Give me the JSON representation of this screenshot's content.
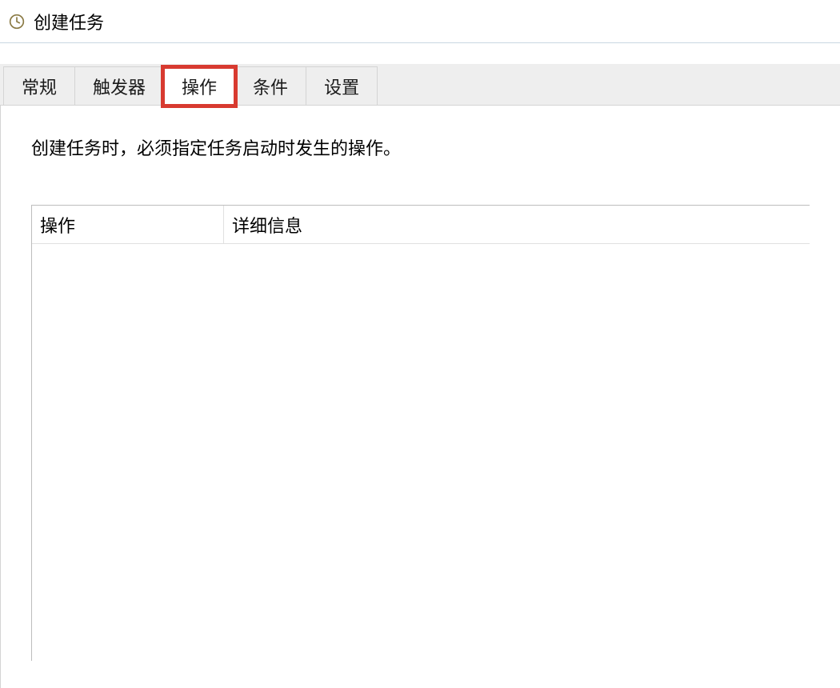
{
  "window": {
    "title": "创建任务"
  },
  "tabs": {
    "items": [
      {
        "label": "常规"
      },
      {
        "label": "触发器"
      },
      {
        "label": "操作"
      },
      {
        "label": "条件"
      },
      {
        "label": "设置"
      }
    ],
    "active_index": 2,
    "highlighted_index": 2
  },
  "panel": {
    "description": "创建任务时，必须指定任务启动时发生的操作。",
    "table": {
      "columns": [
        {
          "label": "操作"
        },
        {
          "label": "详细信息"
        }
      ],
      "rows": []
    }
  }
}
